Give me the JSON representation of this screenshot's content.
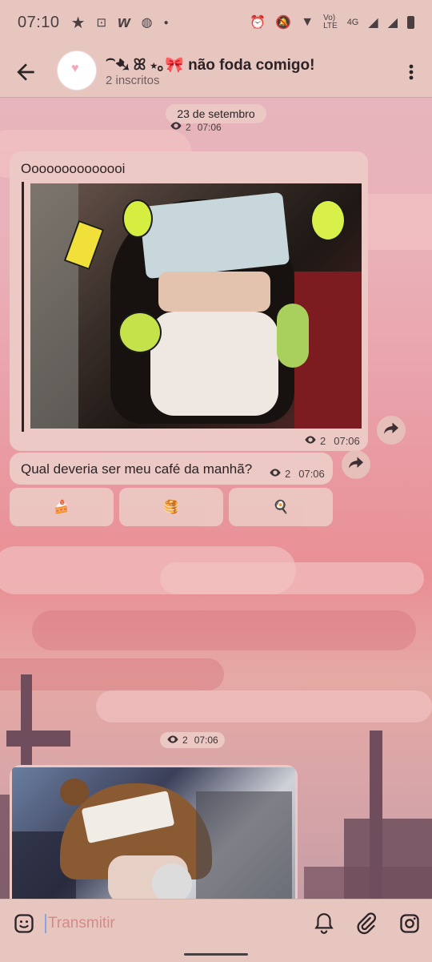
{
  "status_bar": {
    "time": "07:10",
    "network_text": "4G"
  },
  "header": {
    "back_icon": "arrow-left-icon",
    "title": "⁀➷ ꕤ ⋆｡🎀 não foda comigo!",
    "subscribers": "2 inscritos",
    "menu_icon": "more-vert-icon"
  },
  "feed": {
    "date_label": "23 de setembro",
    "top_views": "2",
    "top_time": "07:06",
    "post1": {
      "text": "Oooooooooooooi",
      "views": "2",
      "time": "07:06"
    },
    "post2": {
      "text": "Qual deveria ser meu café da manhã?",
      "views": "2",
      "time": "07:06"
    },
    "reactions": [
      "🍰",
      "🥞",
      "🍳"
    ],
    "post3": {
      "views": "2",
      "time": "07:06"
    }
  },
  "composer": {
    "placeholder": "Transmitir",
    "emoji_icon": "sticker-icon",
    "bell_icon": "bell-icon",
    "attach_icon": "paperclip-icon",
    "instagram_icon": "instagram-icon"
  },
  "colors": {
    "header_bg": "#e8c6c0",
    "bubble_bg": "#ecc9c4",
    "placeholder": "#d58a8a"
  }
}
